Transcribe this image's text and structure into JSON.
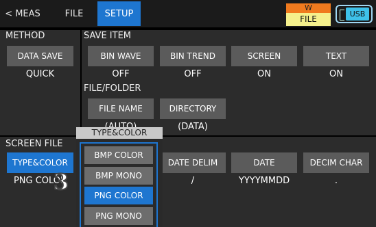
{
  "topbar": {
    "tabs": [
      {
        "label": "< MEAS"
      },
      {
        "label": "FILE"
      },
      {
        "label": "SETUP"
      }
    ],
    "status": {
      "top": "W",
      "bottom": "FILE"
    },
    "usb_label": "USB"
  },
  "method": {
    "title": "METHOD",
    "button_label": "DATA SAVE",
    "value": "QUICK"
  },
  "save_item": {
    "title": "SAVE ITEM",
    "items": [
      {
        "label": "BIN WAVE",
        "value": "OFF"
      },
      {
        "label": "BIN TREND",
        "value": "OFF"
      },
      {
        "label": "SCREEN",
        "value": "ON"
      },
      {
        "label": "TEXT",
        "value": "ON"
      }
    ]
  },
  "file_folder": {
    "title": "FILE/FOLDER",
    "items": [
      {
        "label": "FILE NAME",
        "value": "(AUTO)"
      },
      {
        "label": "DIRECTORY",
        "value": "(DATA)"
      }
    ]
  },
  "screen_file": {
    "title": "SCREEN FILE",
    "type_color": {
      "label": "TYPE&COLOR",
      "value": "PNG COLOR"
    },
    "items": [
      {
        "label": "DATE DELIM",
        "value": "/"
      },
      {
        "label": "DATE",
        "value": "YYYYMMDD"
      },
      {
        "label": "DECIM CHAR",
        "value": "."
      }
    ]
  },
  "popup": {
    "title": "TYPE&COLOR",
    "options": [
      "BMP COLOR",
      "BMP MONO",
      "PNG COLOR",
      "PNG MONO"
    ],
    "selected": "PNG COLOR"
  },
  "callout_marker": "3",
  "colors": {
    "accent": "#1e76d0",
    "panel": "#2c2c2c",
    "button": "#5b5b5b",
    "status_orange": "#f07a1e",
    "status_yellow": "#f5f08c",
    "usb": "#3ec1e9"
  }
}
